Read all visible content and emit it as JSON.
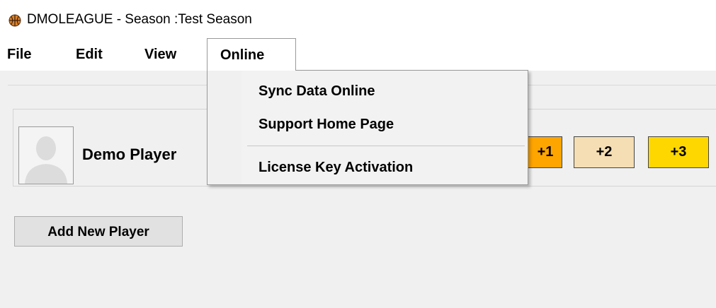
{
  "window": {
    "title": "DMOLEAGUE - Season :Test Season",
    "icon": "basketball-icon"
  },
  "menubar": {
    "items": [
      "File",
      "Edit",
      "View",
      "Online"
    ],
    "active": "Online"
  },
  "online_menu": {
    "items": [
      "Sync Data Online",
      "Support Home Page",
      "License Key Activation"
    ]
  },
  "player": {
    "name": "Demo Player",
    "avatar": "person-silhouette-icon"
  },
  "score_buttons": {
    "b1": "+1",
    "b2": "+2",
    "b3": "+3",
    "colors": {
      "b1": "#ffa500",
      "b2": "#f5deb3",
      "b3": "#ffd700"
    }
  },
  "actions": {
    "add_player": "Add New Player"
  }
}
